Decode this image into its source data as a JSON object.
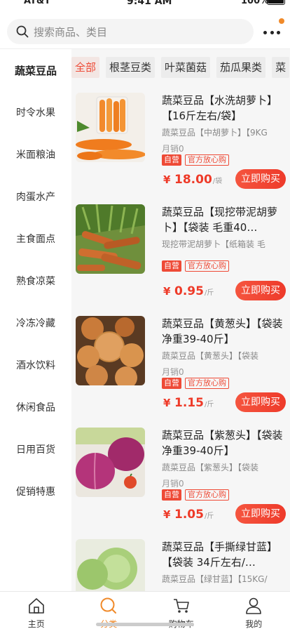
{
  "status_bar": {
    "carrier": "AT&T",
    "time": "9:41 AM",
    "battery": "100%"
  },
  "search": {
    "placeholder": "搜索商品、类目",
    "icon": "search-icon"
  },
  "categories": [
    {
      "label": "蔬菜豆品",
      "active": true
    },
    {
      "label": "时令水果"
    },
    {
      "label": "米面粮油"
    },
    {
      "label": "肉蛋水产"
    },
    {
      "label": "主食面点"
    },
    {
      "label": "熟食凉菜"
    },
    {
      "label": "冷冻冷藏"
    },
    {
      "label": "酒水饮料"
    },
    {
      "label": "休闲食品"
    },
    {
      "label": "日用百货"
    },
    {
      "label": "促销特惠"
    }
  ],
  "tabs": [
    {
      "label": "全部",
      "active": true
    },
    {
      "label": "根茎豆类"
    },
    {
      "label": "叶菜菌菇"
    },
    {
      "label": "茄瓜果类"
    },
    {
      "label": "菜"
    }
  ],
  "products": [
    {
      "title": "蔬菜豆品【水洗胡萝卜】【16斤左右/袋】",
      "subtitle": "蔬菜豆品【中胡萝卜】【9KG",
      "sold": "月销0",
      "tag_self": "自营",
      "tag_official": "官方放心购",
      "price_symbol": "¥",
      "price": "18.00",
      "unit": "/袋",
      "buy_label": "立即购买"
    },
    {
      "title": "蔬菜豆品【现挖带泥胡萝卜】【袋装 毛重40…",
      "subtitle": "现挖带泥胡萝卜【纸箱装 毛",
      "sold": "",
      "tag_self": "自营",
      "tag_official": "官方放心购",
      "price_symbol": "¥",
      "price": "0.95",
      "unit": "/斤",
      "buy_label": "立即购买"
    },
    {
      "title": "蔬菜豆品【黄葱头】【袋装 净重39-40斤】",
      "subtitle": "蔬菜豆品【黄葱头】【袋装 ",
      "sold": "月销0",
      "tag_self": "自营",
      "tag_official": "官方放心购",
      "price_symbol": "¥",
      "price": "1.15",
      "unit": "/斤",
      "buy_label": "立即购买"
    },
    {
      "title": "蔬菜豆品【紫葱头】【袋装 净重39-40斤】",
      "subtitle": "蔬菜豆品【紫葱头】【袋装 ",
      "sold": "月销0",
      "tag_self": "自营",
      "tag_official": "官方放心购",
      "price_symbol": "¥",
      "price": "1.05",
      "unit": "/斤",
      "buy_label": "立即购买"
    },
    {
      "title": "蔬菜豆品【手撕绿甘蓝】【袋装 34斤左右/…",
      "subtitle": "蔬菜豆品【绿甘蓝】【15KG/",
      "sold": "",
      "tag_self": "",
      "tag_official": "",
      "price_symbol": "",
      "price": "",
      "unit": "",
      "buy_label": ""
    }
  ],
  "bottom_nav": [
    {
      "label": "主页",
      "icon": "home-icon"
    },
    {
      "label": "分类",
      "icon": "category-icon",
      "active": true
    },
    {
      "label": "购物车",
      "icon": "cart-icon"
    },
    {
      "label": "我的",
      "icon": "profile-icon"
    }
  ],
  "colors": {
    "accent": "#ee3a28",
    "nav_active": "#f08a2a"
  }
}
